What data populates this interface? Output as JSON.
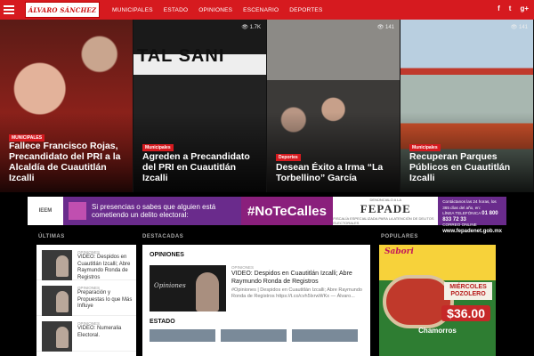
{
  "site": {
    "logo_text": "ÁLVARO SÁNCHEZ"
  },
  "nav": {
    "items": [
      "MUNICIPALES",
      "ESTADO",
      "OPINIONES",
      "ESCENARIO",
      "DEPORTES"
    ]
  },
  "social": {
    "facebook": "f",
    "twitter": "t",
    "google": "g+"
  },
  "hero": [
    {
      "category": "MUNICIPALES",
      "views": "",
      "title": "Fallece Francisco Rojas, Precandidato del PRI a la Alcaldía de Cuautitlán Izcalli",
      "bg": "#8a2a24"
    },
    {
      "category": "Municipales",
      "views": "👁 1.7K",
      "title": "Agreden a Precandidato del PRI en Cuautitlán Izcalli",
      "sign": "TAL SANI",
      "bg": "#2b2b2b"
    },
    {
      "category": "Deportes",
      "views": "👁 141",
      "title": "Desean Éxito a Irma “La Torbellino” García",
      "bg": "#6b6560"
    },
    {
      "category": "Municipales",
      "views": "👁 141",
      "title": "Recuperan Parques Públicos en Cuautitlán Izcalli",
      "bg": "#7ea0b8"
    }
  ],
  "banner": {
    "ieem": "IEEM",
    "text": "Si presencias o sabes que alguien está cometiendo un delito electoral:",
    "hashtag": "#NoTeCalles",
    "fepade_top": "DENÚNCIALO A LA",
    "fepade": "FEPADE",
    "fepade_sub": "FISCALÍA ESPECIALIZADA PARA LA ATENCIÓN DE DELITOS ELECTORALES",
    "contact_line1": "Contáctanos las 24 horas, los 365 días del año, en:",
    "contact_label2": "LÍNEA TELEFÓNICA",
    "contact_phone": "01 800 833 72 33",
    "contact_label3": "CORREO ONLINE",
    "contact_web": "www.fepadenet.gob.mx"
  },
  "columns": {
    "left": "ÚLTIMAS",
    "middle": "DESTACADAS",
    "right": "POPULARES"
  },
  "latest": [
    {
      "category": "OPINIONES",
      "title": "VIDEO: Despidos en Cuautitlán Izcalli; Abre Raymundo Ronda de Registros"
    },
    {
      "category": "OPINIONES",
      "title": "Preparación y Propuestas lo que Más Influye"
    },
    {
      "category": "OPINIONES",
      "title": "VIDEO: Numeralia Electoral."
    }
  ],
  "featured": {
    "section1": "OPINIONES",
    "thumb_label": "Opiniones",
    "category": "OPINIONES",
    "title": "VIDEO: Despidos en Cuautitlán Izcalli; Abre Raymundo Ronda de Registros",
    "excerpt": "#Opiniones | Despidos en Cuautitlán Izcalli; Abre Raymundo Ronda de Registros https://t.co/cvh5lxrwWKx — Álvaro...",
    "section2": "ESTADO"
  },
  "ad": {
    "name": "Sabori",
    "day": "MIÉRCOLES POZOLERO",
    "price": "$36.00",
    "foot": "Chamorros"
  }
}
